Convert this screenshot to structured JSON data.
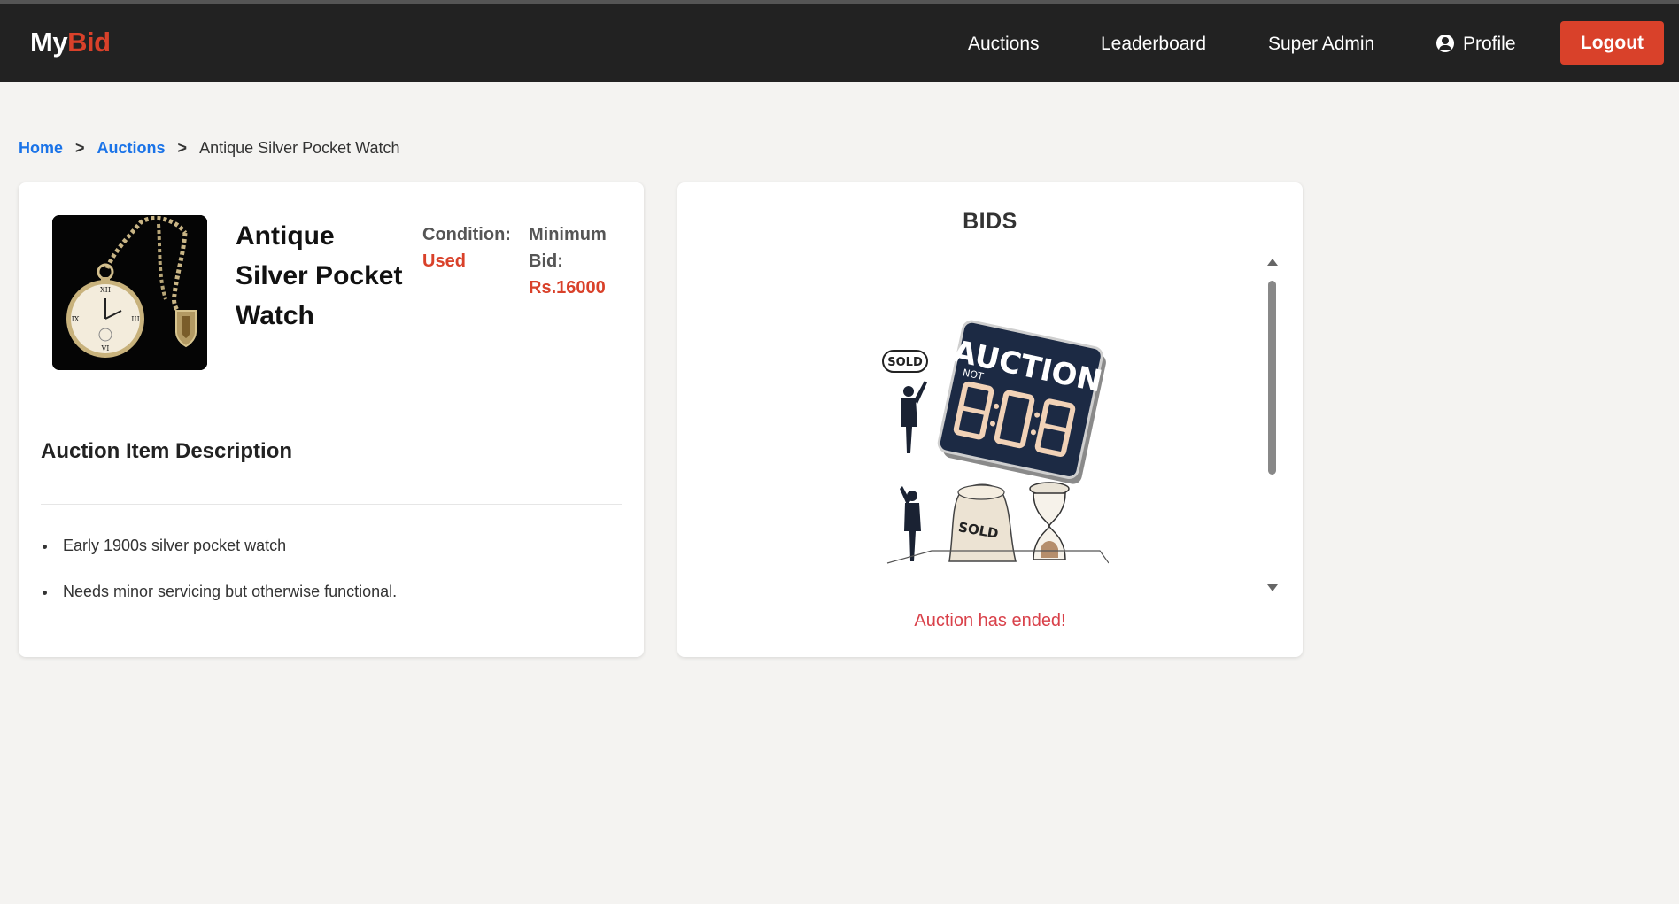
{
  "navbar": {
    "brand_primary": "My",
    "brand_accent": "Bid",
    "links": {
      "auctions": "Auctions",
      "leaderboard": "Leaderboard",
      "super_admin": "Super Admin",
      "profile": "Profile"
    },
    "logout": "Logout",
    "profile_icon": "user-circle-icon"
  },
  "breadcrumb": {
    "home": "Home",
    "sep1": ">",
    "auctions": "Auctions",
    "sep2": ">",
    "current": "Antique Silver Pocket Watch"
  },
  "item": {
    "title": "Antique Silver Pocket Watch",
    "condition_label": "Condition:",
    "condition_value": "Used",
    "min_bid_label": "Minimum Bid:",
    "min_bid_value": "Rs.16000",
    "description_heading": "Auction Item Description",
    "description_points": [
      "Early 1900s silver pocket watch",
      "Needs minor servicing but otherwise functional."
    ]
  },
  "bids": {
    "title": "BIDS",
    "status_message": "Auction has ended!",
    "art_text": {
      "auction": "AUCTION",
      "not": "NOT",
      "sold_sign": "SOLD",
      "sold_cloth": "SOLD"
    }
  },
  "colors": {
    "navbar_bg": "#222222",
    "accent": "#d9412a",
    "link": "#1a73e8",
    "page_bg": "#f4f3f1",
    "ended": "#d9414a"
  }
}
